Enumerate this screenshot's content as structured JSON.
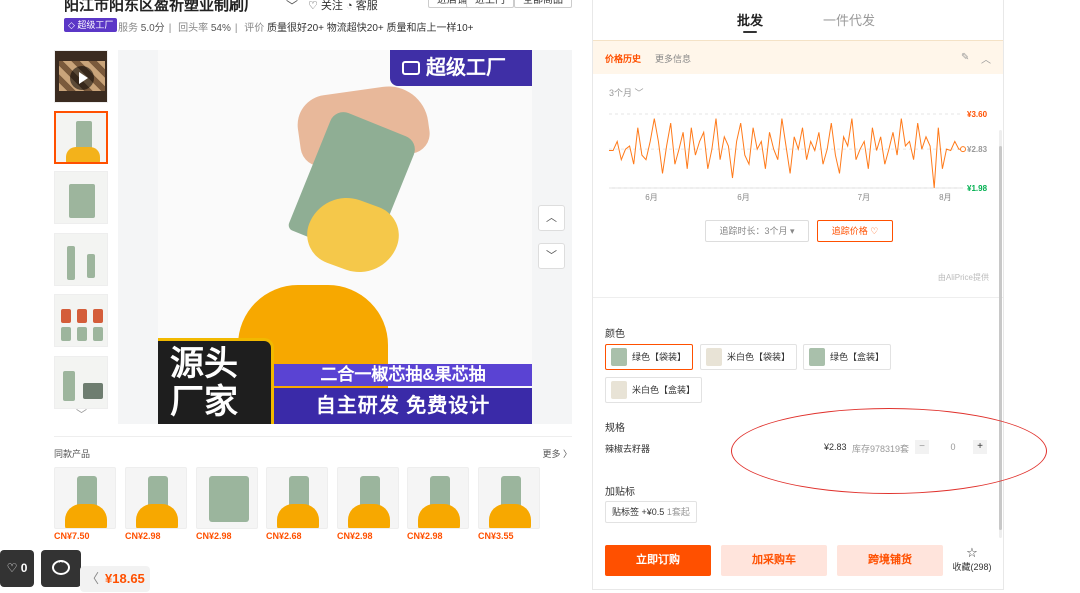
{
  "header": {
    "shop_name": "阳江市阳东区盈祈塑业制刷厂",
    "follow_label": "关注",
    "service_label": "客服",
    "btn_enter": "进店铺",
    "btn_shelf": "进上门",
    "btn_all": "全部商品",
    "factory_badge": "超级工厂",
    "service_score_label": "服务",
    "service_score": "5.0分",
    "repeat_rate_label": "回头率",
    "repeat_rate": "54%",
    "review_label": "评价",
    "tags": [
      "质量很好20+",
      "物流超快20+",
      "质量和店上一样10+"
    ]
  },
  "gallery": {
    "brand_badge": "超级工厂",
    "banner_left": "源头厂家",
    "banner_purple": "二合一椒芯抽&果芯抽",
    "banner_dark": "自主研发  免费设计",
    "nav_up": "︿",
    "nav_down": "﹀",
    "more_thumbs": "﹀"
  },
  "similar": {
    "title": "同款产品",
    "more": "更多 〉",
    "items": [
      {
        "price": "CN¥7.50"
      },
      {
        "price": "CN¥2.98"
      },
      {
        "price": "CN¥2.98"
      },
      {
        "price": "CN¥2.68"
      },
      {
        "price": "CN¥2.98"
      },
      {
        "price": "CN¥2.98"
      },
      {
        "price": "CN¥3.55"
      }
    ]
  },
  "floats": {
    "fav_count": "♡ 0",
    "back_arrow": "〈",
    "price": "¥18.65"
  },
  "tabs": {
    "wholesale": "批发",
    "dropship": "一件代发"
  },
  "price_history": {
    "tab_history": "价格历史",
    "tab_more": "更多信息",
    "range_label": "3个月 ﹀",
    "track_duration": "追踪时长：3个月 ▾",
    "track_price": "追踪价格 ♡",
    "provider": "由AliPrice提供"
  },
  "chart_data": {
    "type": "line",
    "title": "",
    "x_ticks": [
      "6月",
      "6月",
      "7月",
      "8月"
    ],
    "y_ticks": [
      "¥3.60",
      "¥2.83",
      "¥1.98"
    ],
    "y_max": 3.6,
    "y_current": 2.83,
    "y_min": 1.98,
    "ylim": [
      1.98,
      3.6
    ],
    "series": [
      {
        "color": "#ff7a1a",
        "values": [
          2.8,
          2.8,
          3.0,
          2.6,
          2.83,
          2.9,
          2.5,
          3.3,
          2.7,
          2.6,
          3.0,
          3.5,
          3.0,
          2.3,
          2.9,
          3.4,
          2.5,
          2.83,
          3.2,
          2.4,
          3.3,
          2.7,
          3.0,
          3.2,
          2.4,
          2.83,
          3.5,
          2.6,
          3.1,
          2.9,
          2.2,
          3.0,
          3.4,
          2.7,
          2.5,
          3.3,
          2.83,
          3.0,
          2.4,
          3.2,
          2.83,
          2.6,
          3.5,
          2.9,
          2.3,
          3.1,
          2.83,
          3.3,
          2.6,
          3.0,
          2.8,
          3.2,
          2.5,
          2.83,
          3.4,
          2.7,
          2.3,
          3.1,
          2.9,
          3.5,
          2.6,
          2.83,
          3.0,
          2.4,
          3.3,
          2.8,
          3.1,
          2.5,
          2.83,
          3.2,
          2.7,
          3.5,
          2.9,
          3.0,
          2.6,
          3.4,
          2.83,
          3.1,
          2.9,
          1.98,
          3.3,
          2.4,
          2.83,
          2.8,
          3.0,
          2.83,
          2.83
        ]
      }
    ],
    "colors": {
      "max": "#ff5000",
      "min": "#00b050",
      "line": "#ff7a1a"
    }
  },
  "options": {
    "color_label": "颜色",
    "colors": [
      "绿色【袋装】",
      "米白色【袋装】",
      "绿色【盒装】",
      "米白色【盒装】"
    ],
    "spec_label": "规格",
    "spec_name": "辣椒去籽器",
    "spec_price": "¥2.83",
    "spec_stock": "库存978319套",
    "qty_minus": "−",
    "qty_value": "0",
    "qty_plus": "+",
    "addon_label": "加贴标",
    "addon_name": "贴标签",
    "addon_price": "+¥0.5",
    "addon_min": "1套起"
  },
  "actions": {
    "buy_now": "立即订购",
    "add_cart": "加采购车",
    "cross_border": "跨境铺货",
    "collect_icon": "☆",
    "collect_label": "收藏(298)"
  },
  "accent_color": "#ff5000"
}
